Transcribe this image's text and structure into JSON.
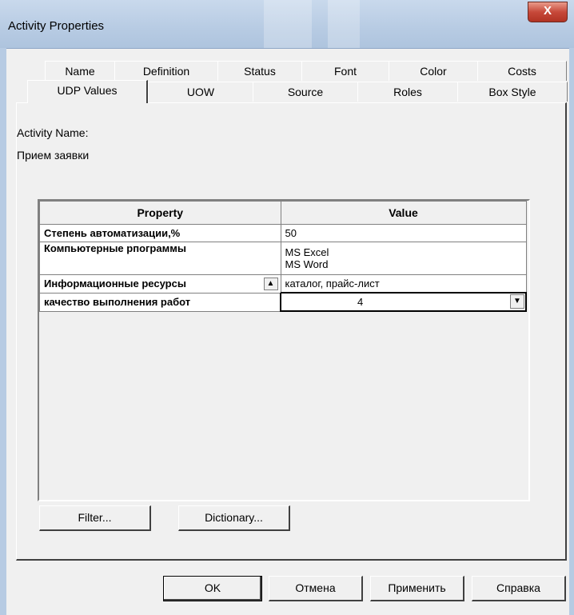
{
  "window": {
    "title": "Activity Properties",
    "close_label": "X"
  },
  "tabs_row1": [
    "Name",
    "Definition",
    "Status",
    "Font",
    "Color",
    "Costs"
  ],
  "tabs_row2": [
    "UDP Values",
    "UOW",
    "Source",
    "Roles",
    "Box Style"
  ],
  "activity": {
    "name_label": "Activity Name:",
    "name_value": "Прием заявки"
  },
  "grid": {
    "headers": [
      "Property",
      "Value"
    ],
    "rows": [
      {
        "property": "Степень автоматизации,%",
        "value": "50"
      },
      {
        "property": "Компьютерные рпограммы",
        "value_lines": [
          "MS Excel",
          "MS Word"
        ]
      },
      {
        "property": "Информационные ресурсы",
        "value": "каталог, прайс-лист"
      },
      {
        "property": "качество выполнения работ",
        "value": "4"
      }
    ]
  },
  "buttons": {
    "filter": "Filter...",
    "dictionary": "Dictionary...",
    "ok": "OK",
    "cancel": "Отмена",
    "apply": "Применить",
    "help": "Справка"
  },
  "icons": {
    "close": "close-icon",
    "scroll_up": "up-arrow-icon",
    "dropdown": "down-arrow-icon"
  }
}
